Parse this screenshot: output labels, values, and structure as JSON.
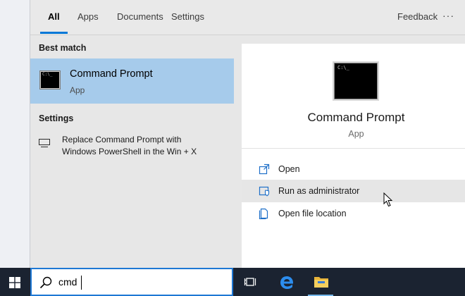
{
  "tabs": [
    {
      "label": "All",
      "active": true
    },
    {
      "label": "Apps",
      "active": false
    },
    {
      "label": "Documents",
      "active": false
    },
    {
      "label": "Settings",
      "active": false
    }
  ],
  "feedback_label": "Feedback",
  "more_icon": "more-options-icon",
  "results": {
    "best_match_label": "Best match",
    "best_match": {
      "title": "Command Prompt",
      "type": "App",
      "icon": "command-prompt-icon"
    },
    "settings_label": "Settings",
    "settings_item": {
      "line1": "Replace Command Prompt with",
      "line2": "Windows PowerShell in the Win + X",
      "icon": "monitor-icon"
    }
  },
  "preview": {
    "title": "Command Prompt",
    "type": "App",
    "actions": [
      {
        "label": "Open",
        "icon": "open-icon"
      },
      {
        "label": "Run as administrator",
        "icon": "shield-icon"
      },
      {
        "label": "Open file location",
        "icon": "file-location-icon"
      }
    ]
  },
  "taskbar": {
    "search_value": "cmd",
    "icons": [
      "windows-start-icon",
      "search-icon",
      "task-view-icon",
      "edge-icon",
      "file-explorer-icon"
    ]
  },
  "colors": {
    "accent": "#0078d7",
    "selected_item": "#a6cbeb",
    "taskbar": "#1b2331"
  }
}
